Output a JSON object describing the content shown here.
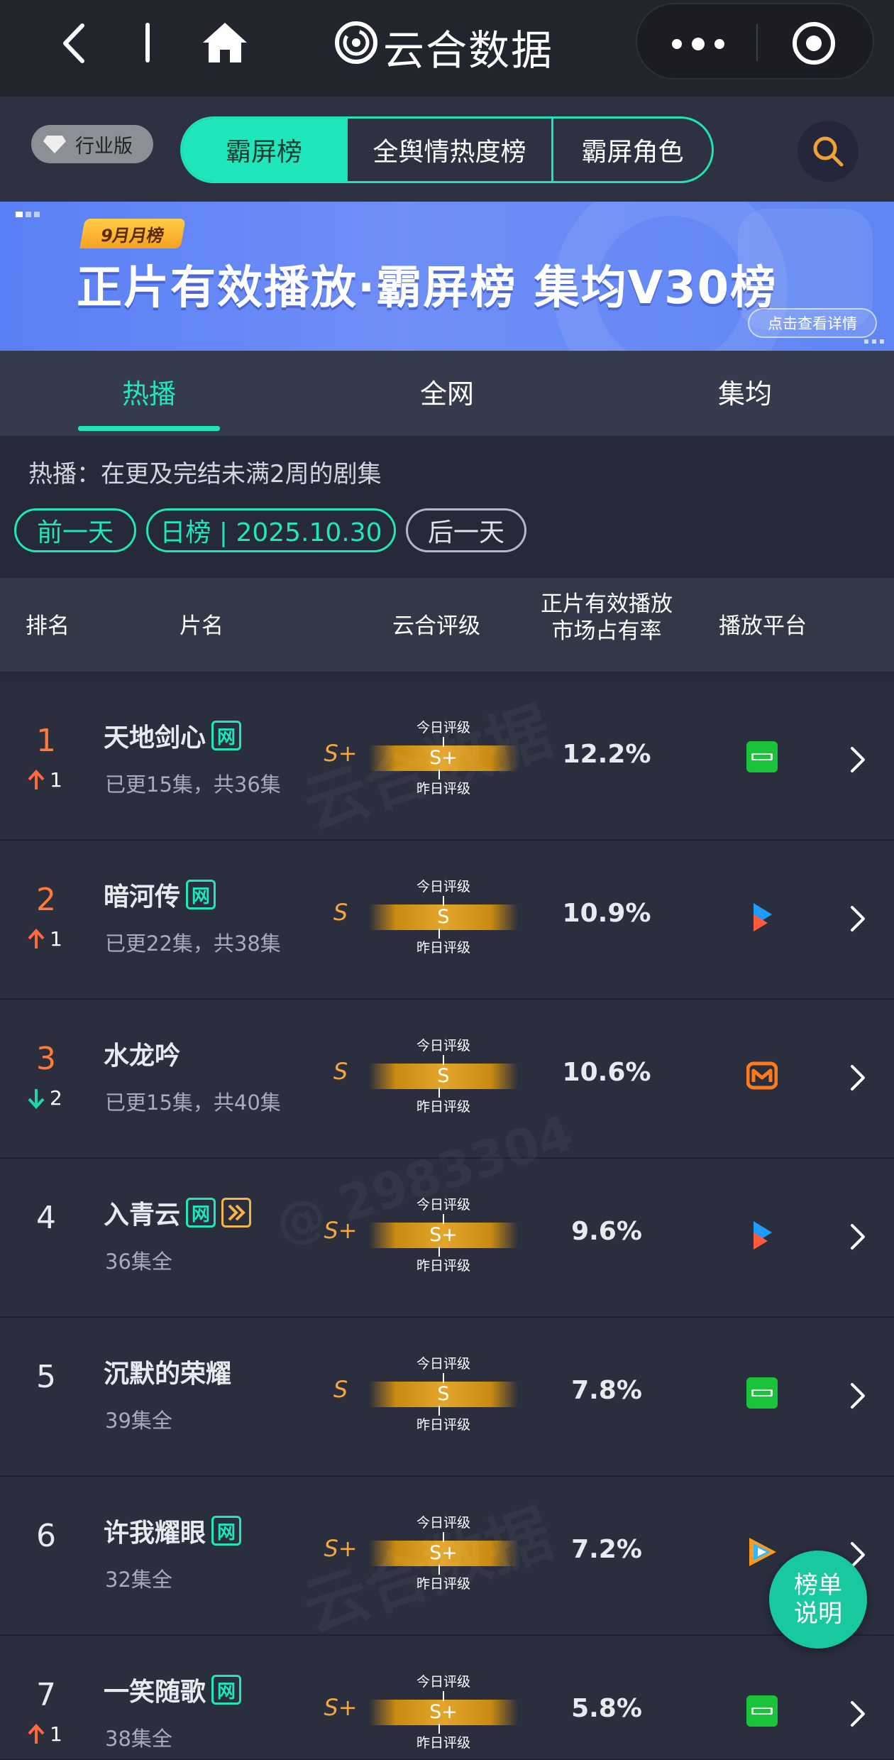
{
  "app": {
    "title": "云合数据",
    "icons": {
      "back": "chevron-left-icon",
      "home": "home-icon",
      "logo": "yunhe-logo",
      "more": "more-dots-icon",
      "close": "target-icon"
    }
  },
  "tabs": {
    "edition": "行业版",
    "items": [
      {
        "label": "霸屏榜",
        "active": true
      },
      {
        "label": "全舆情热度榜",
        "active": false
      },
      {
        "label": "霸屏角色",
        "active": false
      }
    ]
  },
  "banner": {
    "month": "9月月榜",
    "title": "正片有效播放·霸屏榜 集均V30榜",
    "detail": "点击查看详情"
  },
  "subtabs": [
    {
      "label": "热播",
      "active": true
    },
    {
      "label": "全网",
      "active": false
    },
    {
      "label": "集均",
      "active": false
    }
  ],
  "info": {
    "description": "热播：在更及完结未满2周的剧集",
    "prev_day": "前一天",
    "date_label": "日榜 | 2025.10.30",
    "next_day": "后一天"
  },
  "table": {
    "headers": {
      "rank": "排名",
      "title": "片名",
      "grade": "云合评级",
      "share_line1": "正片有效播放",
      "share_line2": "市场占有率",
      "platform": "播放平台"
    },
    "today_label": "今日评级",
    "yesterday_label": "昨日评级",
    "net_tag": "网",
    "rows": [
      {
        "rank": "1",
        "change_dir": "up",
        "change": "1",
        "title": "天地剑心",
        "net": true,
        "fast": false,
        "episodes": "已更15集，共36集",
        "grade": "S+",
        "share": "12.2%",
        "platform": "iqiyi"
      },
      {
        "rank": "2",
        "change_dir": "up",
        "change": "1",
        "title": "暗河传",
        "net": true,
        "fast": false,
        "episodes": "已更22集，共38集",
        "grade": "S",
        "share": "10.9%",
        "platform": "youku"
      },
      {
        "rank": "3",
        "change_dir": "down",
        "change": "2",
        "title": "水龙吟",
        "net": false,
        "fast": false,
        "episodes": "已更15集，共40集",
        "grade": "S",
        "share": "10.6%",
        "platform": "mgtv"
      },
      {
        "rank": "4",
        "change_dir": "",
        "change": "",
        "title": "入青云",
        "net": true,
        "fast": true,
        "episodes": "36集全",
        "grade": "S+",
        "share": "9.6%",
        "platform": "youku"
      },
      {
        "rank": "5",
        "change_dir": "",
        "change": "",
        "title": "沉默的荣耀",
        "net": false,
        "fast": false,
        "episodes": "39集全",
        "grade": "S",
        "share": "7.8%",
        "platform": "iqiyi"
      },
      {
        "rank": "6",
        "change_dir": "",
        "change": "",
        "title": "许我耀眼",
        "net": true,
        "fast": false,
        "episodes": "32集全",
        "grade": "S+",
        "share": "7.2%",
        "platform": "tencent"
      },
      {
        "rank": "7",
        "change_dir": "up",
        "change": "1",
        "title": "一笑随歌",
        "net": true,
        "fast": false,
        "episodes": "38集全",
        "grade": "S+",
        "share": "5.8%",
        "platform": "iqiyi"
      }
    ]
  },
  "help": {
    "label": "榜单说明"
  },
  "colors": {
    "accent": "#1fe7bb",
    "rank_top": "#ff7b3a",
    "grade": "#f4a640",
    "up": "#ff6a3a",
    "down": "#1fd6a8"
  }
}
